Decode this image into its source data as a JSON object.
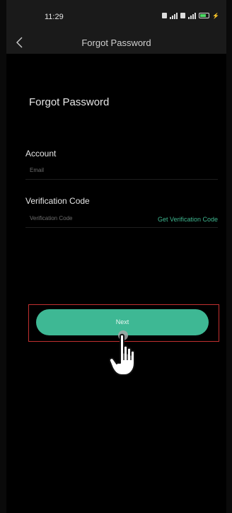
{
  "status_bar": {
    "time": "11:29",
    "network_1": "5G",
    "network_2": "4G"
  },
  "nav": {
    "title": "Forgot Password"
  },
  "form": {
    "heading": "Forgot Password",
    "account": {
      "label": "Account",
      "placeholder": "Email"
    },
    "verification": {
      "label": "Verification Code",
      "placeholder": "Verification Code",
      "get_code_label": "Get Verification Code"
    },
    "next_label": "Next"
  },
  "colors": {
    "accent": "#3eb894",
    "link": "#3fb68f",
    "highlight": "#c23030",
    "background": "#000000",
    "bar": "#1a1a1a"
  },
  "icons": {
    "back": "chevron-left-icon",
    "pointer": "hand-pointer-icon"
  }
}
